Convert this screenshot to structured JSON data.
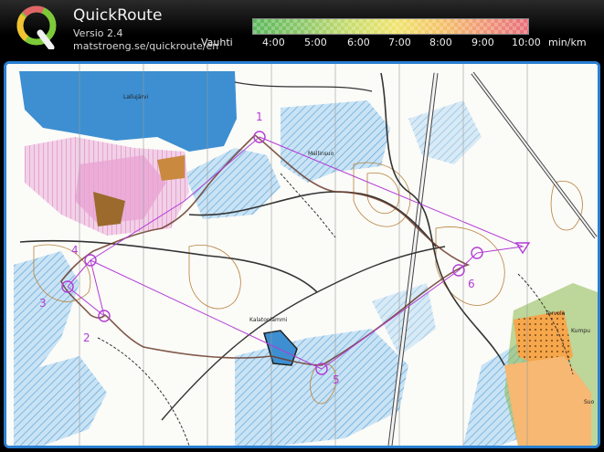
{
  "app": {
    "title": "QuickRoute",
    "version": "Versio 2.4",
    "url": "matstroeng.se/quickroute/en"
  },
  "legend": {
    "label": "Vauhti",
    "ticks": [
      "4:00",
      "5:00",
      "6:00",
      "7:00",
      "8:00",
      "9:00",
      "10:00"
    ],
    "unit": "min/km"
  },
  "map": {
    "place_names": [
      "Lallujärvi",
      "Mallinsuo",
      "Kalatonlammi",
      "Tervola",
      "Kumpu",
      "Suo"
    ],
    "controls": [
      "1",
      "2",
      "3",
      "4",
      "5",
      "6"
    ]
  },
  "colors": {
    "frame": "#2a7fd0",
    "course": "#b23bd6",
    "water": "#3d8fd1",
    "marsh": "#8ec6ea",
    "route": "#6a3b2a"
  }
}
